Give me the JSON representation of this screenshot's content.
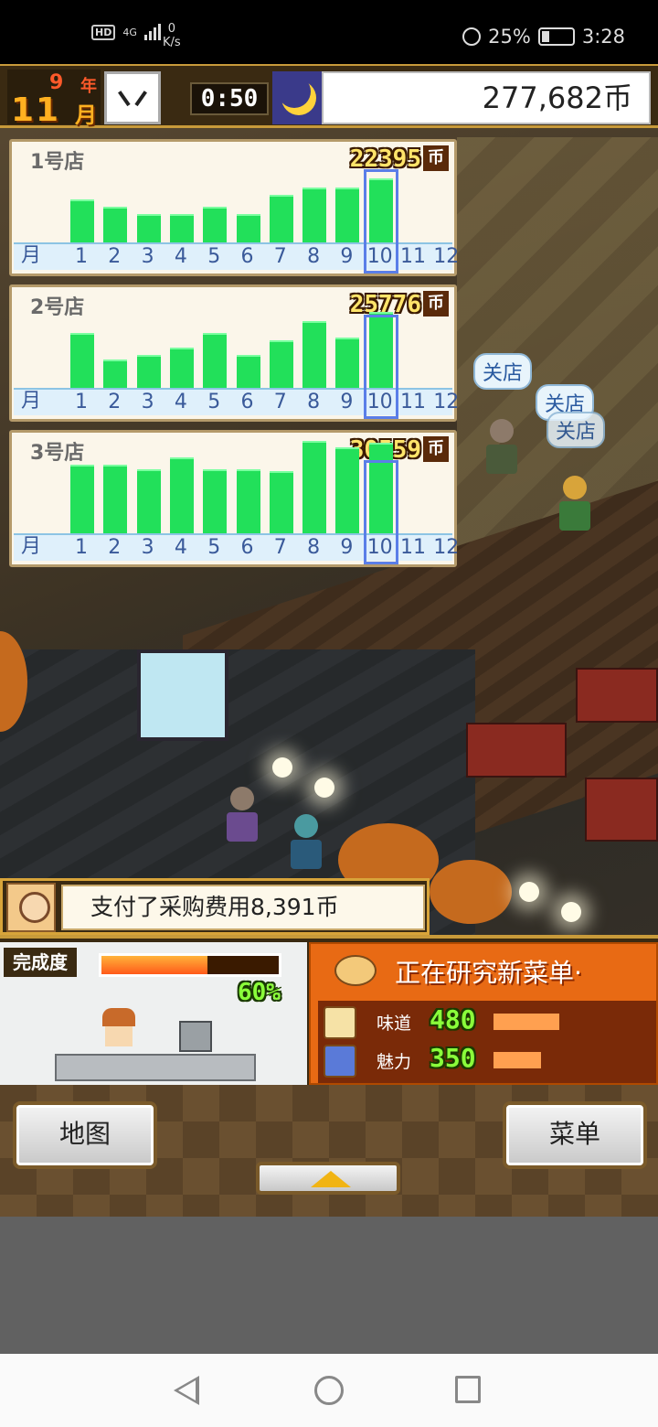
{
  "status_bar": {
    "network_label": "HD",
    "network_type": "4G",
    "speed_value": "0",
    "speed_unit": "K/s",
    "battery_percent": "25%",
    "time": "3:28"
  },
  "hud": {
    "year_number": "9",
    "year_label": "年",
    "month_number": "11",
    "month_label": "月",
    "game_time": "0:50",
    "money": "277,682币",
    "time_of_day_icon": "moon-icon"
  },
  "stores": [
    {
      "name": "1号店",
      "total": "22395",
      "currency_label": "币",
      "selected_month": 10
    },
    {
      "name": "2号店",
      "total": "25776",
      "currency_label": "币",
      "selected_month": 10
    },
    {
      "name": "3号店",
      "total": "30559",
      "currency_label": "币",
      "selected_month": 10
    }
  ],
  "axis": {
    "month_label": "月",
    "months": [
      "1",
      "2",
      "3",
      "4",
      "5",
      "6",
      "7",
      "8",
      "9",
      "10",
      "11",
      "12"
    ]
  },
  "chart_data": [
    {
      "type": "bar",
      "title": "1号店",
      "categories": [
        "1",
        "2",
        "3",
        "4",
        "5",
        "6",
        "7",
        "8",
        "9",
        "10",
        "11",
        "12"
      ],
      "values": [
        36,
        30,
        24,
        24,
        30,
        24,
        40,
        46,
        46,
        54,
        null,
        null
      ],
      "ylim": [
        0,
        80
      ]
    },
    {
      "type": "bar",
      "title": "2号店",
      "categories": [
        "1",
        "2",
        "3",
        "4",
        "5",
        "6",
        "7",
        "8",
        "9",
        "10",
        "11",
        "12"
      ],
      "values": [
        46,
        24,
        28,
        34,
        46,
        28,
        40,
        56,
        42,
        64,
        null,
        null
      ],
      "ylim": [
        0,
        80
      ]
    },
    {
      "type": "bar",
      "title": "3号店",
      "categories": [
        "1",
        "2",
        "3",
        "4",
        "5",
        "6",
        "7",
        "8",
        "9",
        "10",
        "11",
        "12"
      ],
      "values": [
        58,
        58,
        54,
        64,
        54,
        54,
        52,
        78,
        72,
        76,
        null,
        null
      ],
      "ylim": [
        0,
        80
      ]
    }
  ],
  "scene": {
    "bubble_labels": [
      "关店",
      "关店",
      "关店"
    ]
  },
  "message": {
    "text": "支付了采购费用8,391币"
  },
  "kitchen": {
    "label": "完成度",
    "progress_percent": "60%",
    "progress_fraction": 0.6
  },
  "research": {
    "title": "正在研究新菜单·",
    "stats": [
      {
        "label": "味道",
        "value": "480",
        "bar_fraction": 0.9,
        "icon": "taste-icon"
      },
      {
        "label": "魅力",
        "value": "350",
        "bar_fraction": 0.65,
        "icon": "charm-icon"
      }
    ]
  },
  "buttons": {
    "map": "地图",
    "menu": "菜单"
  }
}
